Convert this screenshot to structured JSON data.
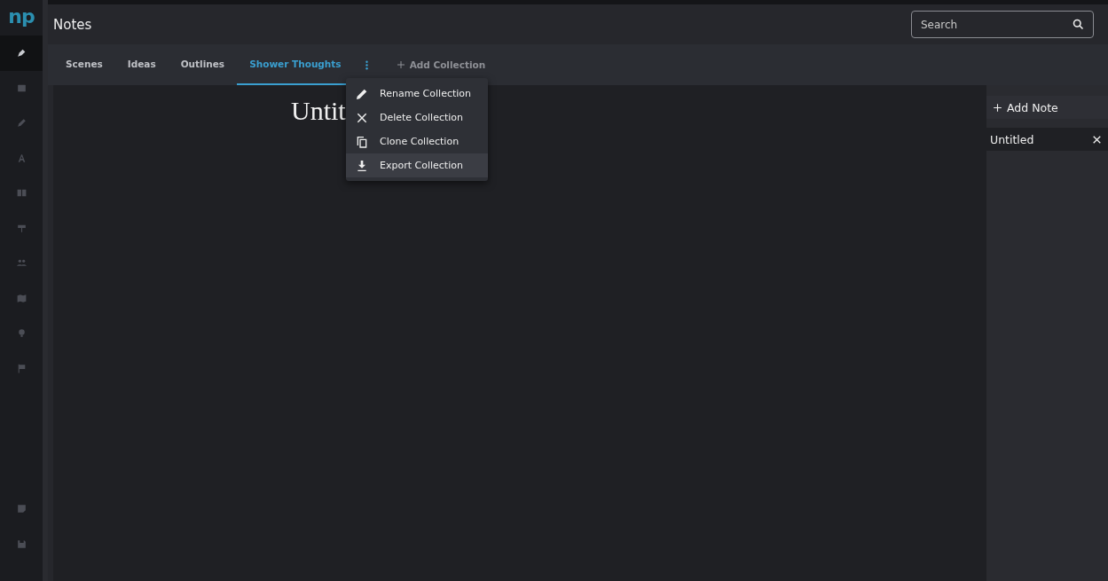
{
  "logo": "np",
  "sidebar": {
    "items": [
      {
        "selected": true
      },
      {
        "selected": false
      },
      {
        "selected": false
      },
      {
        "selected": false
      },
      {
        "selected": false
      },
      {
        "selected": false
      },
      {
        "selected": false
      },
      {
        "selected": false
      },
      {
        "selected": false
      },
      {
        "selected": false
      }
    ],
    "bottom_items": [
      {
        "selected": false
      },
      {
        "selected": false
      }
    ]
  },
  "header": {
    "title": "Notes",
    "search": {
      "placeholder": "Search"
    }
  },
  "tabs": [
    {
      "label": "Scenes",
      "selected": false
    },
    {
      "label": "Ideas",
      "selected": false
    },
    {
      "label": "Outlines",
      "selected": false
    },
    {
      "label": "Shower Thoughts",
      "selected": true
    }
  ],
  "add_collection": "Add Collection",
  "menu": [
    {
      "label": "Rename Collection",
      "highlighted": false
    },
    {
      "label": "Delete Collection",
      "highlighted": false
    },
    {
      "label": "Clone Collection",
      "highlighted": false
    },
    {
      "label": "Export Collection",
      "highlighted": true
    }
  ],
  "editor": {
    "title": "Untit"
  },
  "notes_panel": {
    "add_note": "Add Note",
    "notes": [
      {
        "title": "Untitled",
        "selected": true
      }
    ]
  }
}
